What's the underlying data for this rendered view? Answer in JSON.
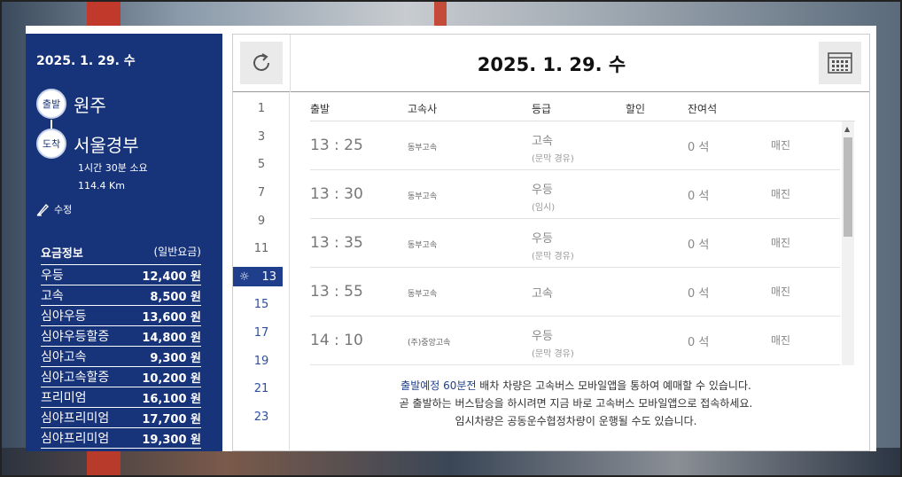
{
  "left": {
    "date": "2025. 1. 29. 수",
    "departure_badge": "출발",
    "departure": "원주",
    "arrival_badge": "도착",
    "arrival": "서울경부",
    "duration": "1시간 30분 소요",
    "distance": "114.4 Km",
    "edit_label": "수정",
    "fare": {
      "header": "요금정보",
      "header_note": "(일반요금)",
      "items": [
        {
          "grade": "우등",
          "price": "12,400 원"
        },
        {
          "grade": "고속",
          "price": "8,500 원"
        },
        {
          "grade": "심야우등",
          "price": "13,600 원"
        },
        {
          "grade": "심야우등할증",
          "price": "14,800 원"
        },
        {
          "grade": "심야고속",
          "price": "9,300 원"
        },
        {
          "grade": "심야고속할증",
          "price": "10,200 원"
        },
        {
          "grade": "프리미엄",
          "price": "16,100 원"
        },
        {
          "grade": "심야프리미엄",
          "price": "17,700 원"
        },
        {
          "grade": "심야프리미엄",
          "price": "19,300 원"
        }
      ]
    }
  },
  "header": {
    "title": "2025. 1. 29. 수",
    "refresh_icon": "refresh-icon",
    "calendar_icon": "calendar-icon"
  },
  "hours": [
    "1",
    "3",
    "5",
    "7",
    "9",
    "11",
    "13",
    "15",
    "17",
    "19",
    "21",
    "23"
  ],
  "selected_hour": "13",
  "table": {
    "columns": [
      "출발",
      "고속사",
      "등급",
      "할인",
      "잔여석"
    ],
    "rows": [
      {
        "time": "13 : 25",
        "company": "동부고속",
        "grade": "고속",
        "grade_sub": "(문막 경유)",
        "seats": "0 석",
        "status": "매진"
      },
      {
        "time": "13 : 30",
        "company": "동부고속",
        "grade": "우등",
        "grade_sub": "(임시)",
        "seats": "0 석",
        "status": "매진"
      },
      {
        "time": "13 : 35",
        "company": "동부고속",
        "grade": "우등",
        "grade_sub": "(문막 경유)",
        "seats": "0 석",
        "status": "매진"
      },
      {
        "time": "13 : 55",
        "company": "동부고속",
        "grade": "고속",
        "grade_sub": "",
        "seats": "0 석",
        "status": "매진"
      },
      {
        "time": "14 : 10",
        "company": "(주)중앙고속",
        "grade": "우등",
        "grade_sub": "(문막 경유)",
        "seats": "0 석",
        "status": "매진"
      }
    ]
  },
  "notice": {
    "line1_highlight": "출발예정 60분전",
    "line1_rest": " 배차 차량은 고속버스 모바일앱을 통하여 예매할 수 있습니다.",
    "line2": "곧 출발하는 버스탑승을 하시려면 지금 바로 고속버스 모바일앱으로 접속하세요.",
    "line3": "임시차량은 공동운수협정차량이 운행될 수도 있습니다."
  }
}
